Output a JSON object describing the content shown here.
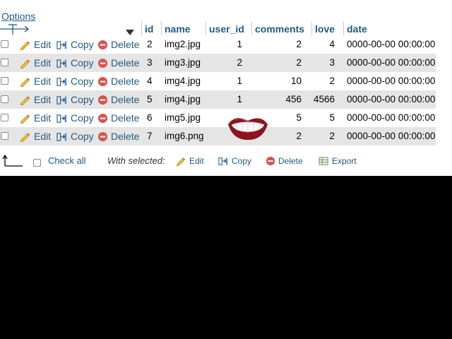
{
  "options_link": "Options",
  "columns": [
    "id",
    "name",
    "user_id",
    "comments",
    "love",
    "date"
  ],
  "action_labels": {
    "edit": "Edit",
    "copy": "Copy",
    "delete": "Delete"
  },
  "rows": [
    {
      "id": "2",
      "name": "img2.jpg",
      "user_id": "1",
      "comments": "2",
      "love": "4",
      "date": "0000-00-00 00:00:00"
    },
    {
      "id": "3",
      "name": "img3.jpg",
      "user_id": "2",
      "comments": "2",
      "love": "3",
      "date": "0000-00-00 00:00:00"
    },
    {
      "id": "4",
      "name": "img4.jpg",
      "user_id": "1",
      "comments": "10",
      "love": "2",
      "date": "0000-00-00 00:00:00"
    },
    {
      "id": "5",
      "name": "img4.jpg",
      "user_id": "1",
      "comments": "456",
      "love": "4566",
      "date": "0000-00-00 00:00:00"
    },
    {
      "id": "6",
      "name": "img5.jpg",
      "user_id": "",
      "comments": "5",
      "love": "5",
      "date": "0000-00-00 00:00:00"
    },
    {
      "id": "7",
      "name": "img6.png",
      "user_id": "",
      "comments": "2",
      "love": "2",
      "date": "0000-00-00 00:00:00"
    }
  ],
  "footer": {
    "check_all": "Check all",
    "with_selected": "With selected:",
    "edit": "Edit",
    "copy": "Copy",
    "delete": "Delete",
    "export": "Export"
  },
  "colors": {
    "link": "#235a81",
    "row_alt": "#e5e5e5",
    "background": "#000000"
  }
}
